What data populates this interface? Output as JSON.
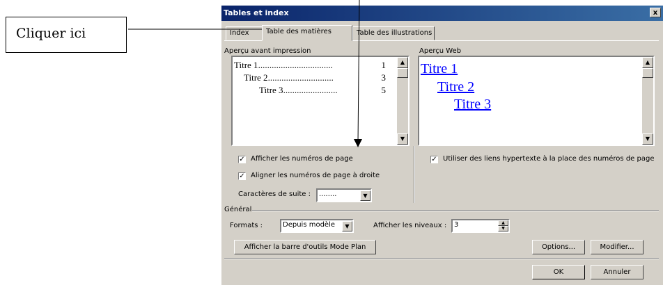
{
  "callout": {
    "text": "Cliquer ici"
  },
  "dialog": {
    "title": "Tables et index",
    "close_glyph": "x",
    "tabs": [
      {
        "label": "Index"
      },
      {
        "label": "Table des matières"
      },
      {
        "label": "Table des illustrations"
      }
    ],
    "print_preview": {
      "label": "Aperçu avant impression",
      "entries": [
        {
          "title": "Titre 1",
          "dots": ".................................",
          "page": "1"
        },
        {
          "title": "Titre 2",
          "dots": ".............................",
          "page": "3"
        },
        {
          "title": "Titre 3",
          "dots": "........................",
          "page": "5"
        }
      ]
    },
    "web_preview": {
      "label": "Aperçu Web",
      "links": [
        "Titre 1",
        "Titre 2",
        "Titre 3"
      ]
    },
    "options": {
      "show_page_numbers": {
        "label": "Afficher les numéros de page",
        "checked": true
      },
      "align_right": {
        "label": "Aligner les numéros de page à droite",
        "checked": true
      },
      "use_hyperlinks": {
        "label": "Utiliser des liens hypertexte à la place des numéros de page",
        "checked": true
      },
      "tab_leader": {
        "label": "Caractères de suite :",
        "value": "........"
      }
    },
    "general": {
      "label": "Général",
      "formats_label": "Formats :",
      "formats_value": "Depuis modèle",
      "levels_label": "Afficher les niveaux :",
      "levels_value": "3"
    },
    "buttons": {
      "outline_toolbar": "Afficher la barre d'outils Mode Plan",
      "options": "Options...",
      "modify": "Modifier...",
      "ok": "OK",
      "cancel": "Annuler"
    }
  }
}
